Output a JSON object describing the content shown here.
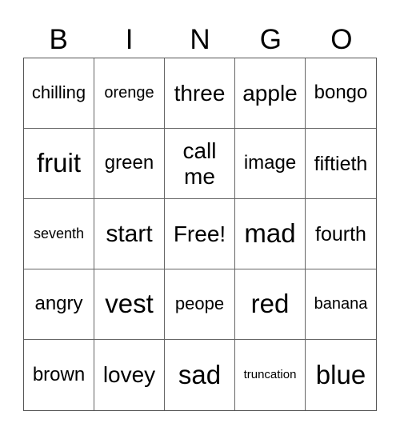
{
  "header": [
    "B",
    "I",
    "N",
    "G",
    "O"
  ],
  "cells": [
    "chilling",
    "orenge",
    "three",
    "apple",
    "bongo",
    "fruit",
    "green",
    "call me",
    "image",
    "fiftieth",
    "seventh",
    "start",
    "Free!",
    "mad",
    "fourth",
    "angry",
    "vest",
    "peope",
    "red",
    "banana",
    "brown",
    "lovey",
    "sad",
    "truncation",
    "blue"
  ]
}
